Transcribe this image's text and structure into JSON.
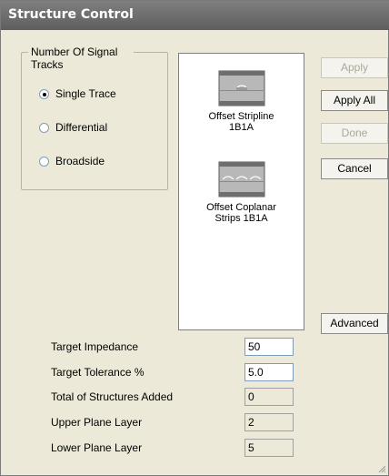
{
  "window": {
    "title": "Structure Control"
  },
  "signal_tracks": {
    "legend": "Number Of Signal Tracks",
    "options": [
      {
        "label": "Single Trace",
        "checked": true
      },
      {
        "label": "Differential",
        "checked": false
      },
      {
        "label": "Broadside",
        "checked": false
      }
    ]
  },
  "structures": [
    {
      "label_line1": "Offset Stripline",
      "label_line2": "1B1A",
      "icon": "offset-stripline-icon"
    },
    {
      "label_line1": "Offset Coplanar",
      "label_line2": "Strips 1B1A",
      "icon": "offset-coplanar-strips-icon"
    }
  ],
  "buttons": {
    "apply": "Apply",
    "apply_all": "Apply All",
    "done": "Done",
    "cancel": "Cancel",
    "advanced": "Advanced"
  },
  "fields": {
    "target_impedance": {
      "label": "Target Impedance",
      "value": "50"
    },
    "target_tolerance": {
      "label": "Target Tolerance %",
      "value": "5.0"
    },
    "total_structures": {
      "label": "Total of Structures Added",
      "value": "0"
    },
    "upper_plane": {
      "label": "Upper Plane Layer",
      "value": "2"
    },
    "lower_plane": {
      "label": "Lower Plane Layer",
      "value": "5"
    }
  }
}
